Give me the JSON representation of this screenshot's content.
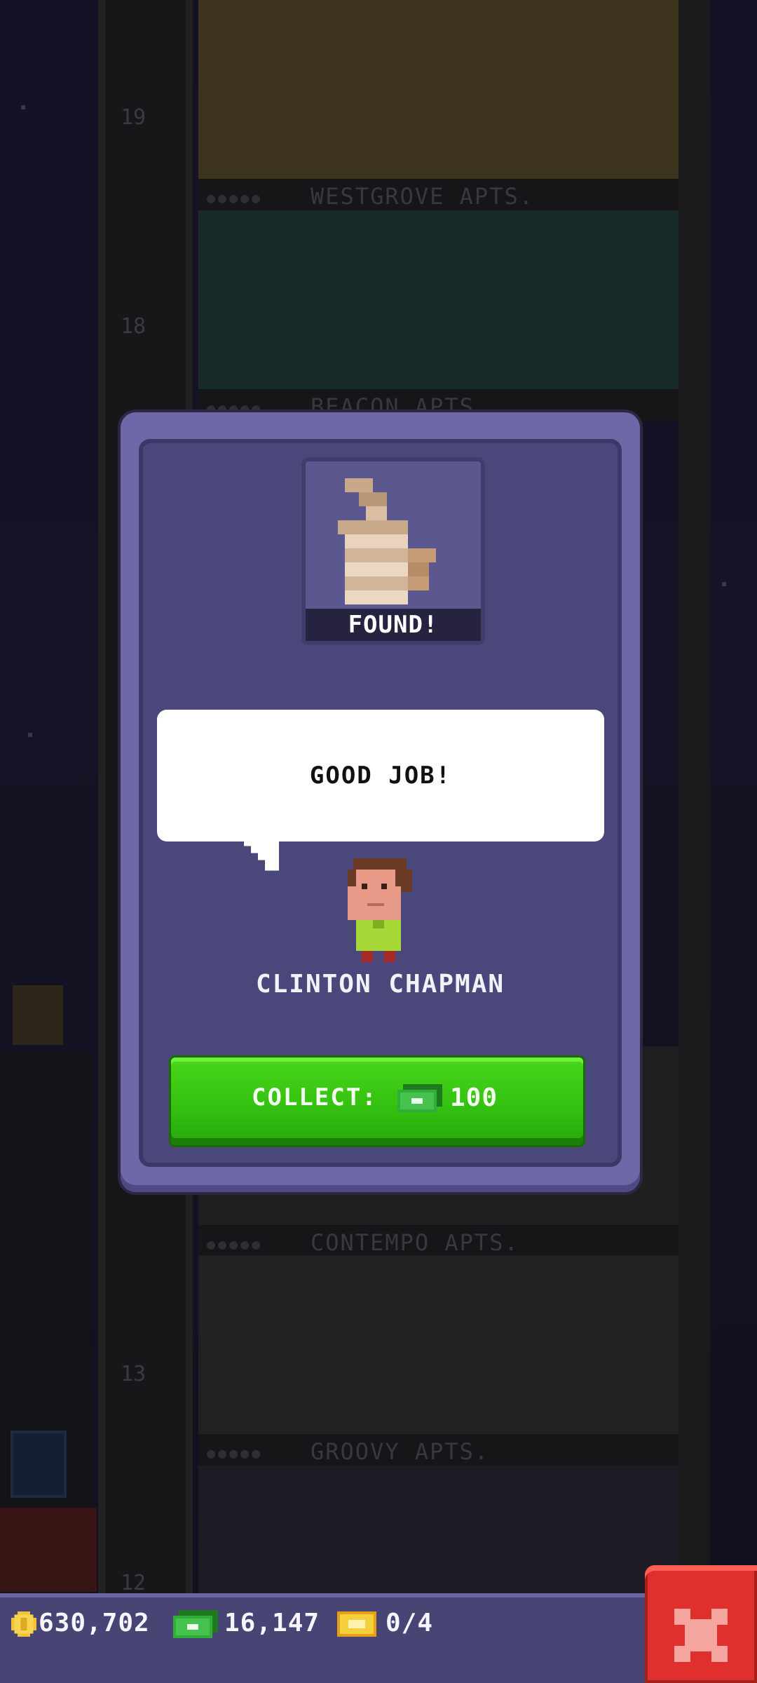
{
  "background": {
    "floors": [
      {
        "number": "19",
        "sign": "WESTGROVE APTS."
      },
      {
        "number": "18",
        "sign": "BEACON APTS."
      },
      {
        "number": "13",
        "sign": "CONTEMPO APTS."
      },
      {
        "number": "12",
        "sign": "GROOVY APTS."
      }
    ]
  },
  "modal": {
    "item_name": "thumbs-up-icon",
    "status_label": "FOUND!",
    "speech": "GOOD JOB!",
    "npc_name": "CLINTON CHAPMAN",
    "collect_label": "COLLECT:",
    "collect_amount": "100"
  },
  "status_bar": {
    "coins": "630,702",
    "bux": "16,147",
    "tickets": "0/4"
  },
  "colors": {
    "modal_frame": "#6d68a8",
    "modal_panel": "#4a477a",
    "collect_green": "#3cc512",
    "close_red": "#e0302d"
  }
}
